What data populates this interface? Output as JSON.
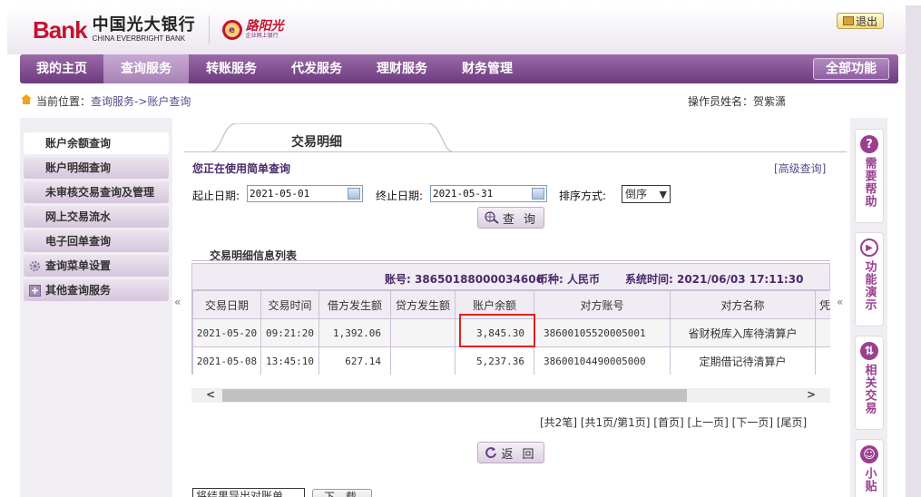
{
  "header": {
    "bank_mark": "Bank",
    "bank_name_cn": "中国光大银行",
    "bank_name_en": "CHINA EVERBRIGHT BANK",
    "sub_brand": "路阳光",
    "sub_brand_caption": "企业网上银行",
    "logout_label": "退出"
  },
  "nav": {
    "items": [
      "我的主页",
      "查询服务",
      "转账服务",
      "代发服务",
      "理财服务",
      "财务管理"
    ],
    "active": "查询服务",
    "all_functions_label": "全部功能"
  },
  "breadcrumb": {
    "prefix": "当前位置：",
    "path": "查询服务->账户查询",
    "operator": "操作员姓名：贺紫潇"
  },
  "sidebar": {
    "items": [
      "账户余额查询",
      "账户明细查询",
      "未审核交易查询及管理",
      "网上交易流水",
      "电子回单查询",
      "查询菜单设置",
      "其他查询服务"
    ],
    "collapse_glyph": "«"
  },
  "main": {
    "tab_label": "交易明细",
    "simple_query_label": "您正在使用简单查询",
    "advanced_link": "[高级查询]",
    "start_date_label": "起止日期:",
    "start_date": "2021-05-01",
    "end_date_label": "终止日期:",
    "end_date": "2021-05-31",
    "sort_label": "排序方式:",
    "sort_value": "倒序",
    "query_button": "查 询",
    "list_title": "交易明细信息列表",
    "account_label": "账号: 38650188000034606",
    "currency_label": "币种: 人民币",
    "system_time_label": "系统时间: 2021/06/03  17:11:30",
    "table": {
      "columns": [
        "交易日期",
        "交易时间",
        "借方发生额",
        "贷方发生额",
        "账户余额",
        "对方账号",
        "对方名称",
        "凭"
      ],
      "rows": [
        [
          "2021-05-20",
          "09:21:20",
          "1,392.06",
          "",
          "3,845.30",
          "38600105520005001",
          "省财税库入库待清算户",
          ""
        ],
        [
          "2021-05-08",
          "13:45:10",
          "627.14",
          "",
          "5,237.36",
          "38600104490005000",
          "定期借记待清算户",
          ""
        ]
      ]
    },
    "pager": "[共2笔] [共1页/第1页] [首页] [上一页] [下一页] [尾页]",
    "back_button": "返 回",
    "record_select": "将结果导出对账单",
    "download_button": "下 载"
  },
  "right_rail": {
    "collapse_glyph": "«",
    "cards": [
      "需要帮助",
      "功能演示",
      "相关交易",
      "小贴"
    ]
  },
  "colors": {
    "brand_purple": "#6d3b7e",
    "brand_red": "#c4122f",
    "highlight_red": "#e0201d"
  }
}
